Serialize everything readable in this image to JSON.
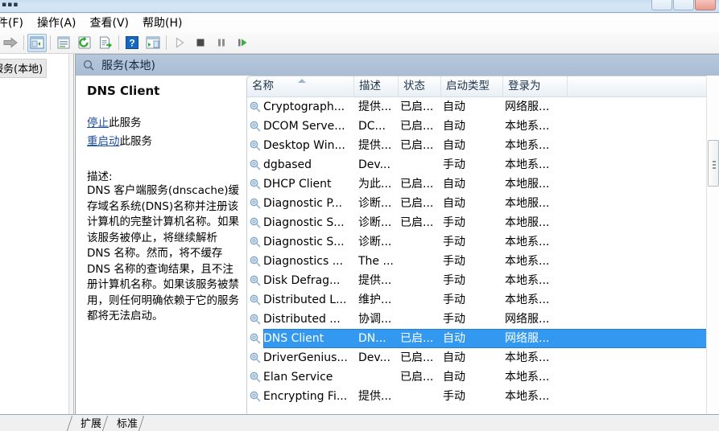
{
  "window": {
    "titlebar_icon": "services-app-icon",
    "buttons": [
      "minimize",
      "maximize",
      "close"
    ]
  },
  "menu": {
    "items": [
      {
        "label": "件(F)",
        "name": "menu-file"
      },
      {
        "label": "操作(A)",
        "name": "menu-action"
      },
      {
        "label": "查看(V)",
        "name": "menu-view"
      },
      {
        "label": "帮助(H)",
        "name": "menu-help"
      }
    ]
  },
  "toolbar": {
    "buttons": [
      {
        "name": "forward-button",
        "icon": "arrow-right-icon",
        "enabled": true,
        "pressed": false
      },
      {
        "name": "show-hide-tree-button",
        "icon": "console-tree-icon",
        "enabled": true,
        "pressed": true
      },
      {
        "name": "properties-button",
        "icon": "properties-icon",
        "enabled": true,
        "pressed": false
      },
      {
        "name": "refresh-button",
        "icon": "refresh-icon",
        "enabled": true,
        "pressed": false
      },
      {
        "name": "export-list-button",
        "icon": "export-list-icon",
        "enabled": true,
        "pressed": false
      },
      {
        "name": "help-button",
        "icon": "help-question-icon",
        "enabled": true,
        "pressed": false
      },
      {
        "name": "show-action-pane-button",
        "icon": "action-pane-icon",
        "enabled": true,
        "pressed": false
      },
      {
        "name": "start-service-button",
        "icon": "play-icon",
        "enabled": false,
        "pressed": false
      },
      {
        "name": "stop-service-button",
        "icon": "stop-icon",
        "enabled": true,
        "pressed": false
      },
      {
        "name": "pause-service-button",
        "icon": "pause-icon",
        "enabled": true,
        "pressed": false
      },
      {
        "name": "restart-service-button",
        "icon": "restart-icon",
        "enabled": true,
        "pressed": false
      }
    ]
  },
  "tree": {
    "items": [
      {
        "label": "服务(本地)",
        "name": "tree-item-services-local",
        "selected": true
      }
    ]
  },
  "pane": {
    "header_title": "服务(本地)",
    "header_icon": "services-gear-icon"
  },
  "detail": {
    "service_name": "DNS Client",
    "links": [
      {
        "link_text": "停止",
        "tail_text": "此服务",
        "name": "stop-service-link"
      },
      {
        "link_text": "重启动",
        "tail_text": "此服务",
        "name": "restart-service-link"
      }
    ],
    "description_label": "描述:",
    "description": "DNS 客户端服务(dnscache)缓存域名系统(DNS)名称并注册该计算机的完整计算机名称。如果该服务被停止，将继续解析 DNS 名称。然而，将不缓存 DNS 名称的查询结果，且不注册计算机名称。如果该服务被禁用，则任何明确依赖于它的服务都将无法启动。"
  },
  "list": {
    "columns": [
      {
        "label": "名称",
        "name": "column-name",
        "sorted": "asc"
      },
      {
        "label": "描述",
        "name": "column-description"
      },
      {
        "label": "状态",
        "name": "column-status"
      },
      {
        "label": "启动类型",
        "name": "column-startup-type"
      },
      {
        "label": "登录为",
        "name": "column-log-on-as"
      }
    ],
    "rows": [
      {
        "name": "Cryptograph...",
        "description": "提供...",
        "status": "已启...",
        "startup": "自动",
        "logon": "网络服...",
        "selected": false
      },
      {
        "name": "DCOM Serve...",
        "description": "DC...",
        "status": "已启...",
        "startup": "自动",
        "logon": "本地系...",
        "selected": false
      },
      {
        "name": "Desktop Win...",
        "description": "提供...",
        "status": "已启...",
        "startup": "自动",
        "logon": "本地系...",
        "selected": false
      },
      {
        "name": "dgbased",
        "description": "Dev...",
        "status": "",
        "startup": "手动",
        "logon": "本地系...",
        "selected": false
      },
      {
        "name": "DHCP Client",
        "description": "为此...",
        "status": "已启...",
        "startup": "自动",
        "logon": "本地服...",
        "selected": false
      },
      {
        "name": "Diagnostic P...",
        "description": "诊断...",
        "status": "已启...",
        "startup": "自动",
        "logon": "本地服...",
        "selected": false
      },
      {
        "name": "Diagnostic S...",
        "description": "诊断...",
        "status": "已启...",
        "startup": "手动",
        "logon": "本地服...",
        "selected": false
      },
      {
        "name": "Diagnostic S...",
        "description": "诊断...",
        "status": "",
        "startup": "手动",
        "logon": "本地系...",
        "selected": false
      },
      {
        "name": "Diagnostics ...",
        "description": "The ...",
        "status": "",
        "startup": "手动",
        "logon": "本地系...",
        "selected": false
      },
      {
        "name": "Disk Defrag...",
        "description": "提供...",
        "status": "",
        "startup": "手动",
        "logon": "本地系...",
        "selected": false
      },
      {
        "name": "Distributed L...",
        "description": "维护...",
        "status": "",
        "startup": "手动",
        "logon": "本地系...",
        "selected": false
      },
      {
        "name": "Distributed ...",
        "description": "协调...",
        "status": "",
        "startup": "手动",
        "logon": "网络服...",
        "selected": false
      },
      {
        "name": "DNS Client",
        "description": "DN...",
        "status": "已启...",
        "startup": "自动",
        "logon": "网络服...",
        "selected": true
      },
      {
        "name": "DriverGenius...",
        "description": "Dev...",
        "status": "已启...",
        "startup": "自动",
        "logon": "本地系...",
        "selected": false
      },
      {
        "name": "Elan Service",
        "description": "",
        "status": "已启...",
        "startup": "自动",
        "logon": "本地系...",
        "selected": false
      },
      {
        "name": "Encrypting Fi...",
        "description": "提供...",
        "status": "",
        "startup": "手动",
        "logon": "本地系...",
        "selected": false
      }
    ]
  },
  "tabs": [
    {
      "label": "扩展",
      "name": "tab-extended",
      "active": false
    },
    {
      "label": "标准",
      "name": "tab-standard",
      "active": true
    }
  ],
  "colors": {
    "selection": "#3399f0",
    "header_bar": "#a9bcd3",
    "link": "#1d4fa0"
  }
}
